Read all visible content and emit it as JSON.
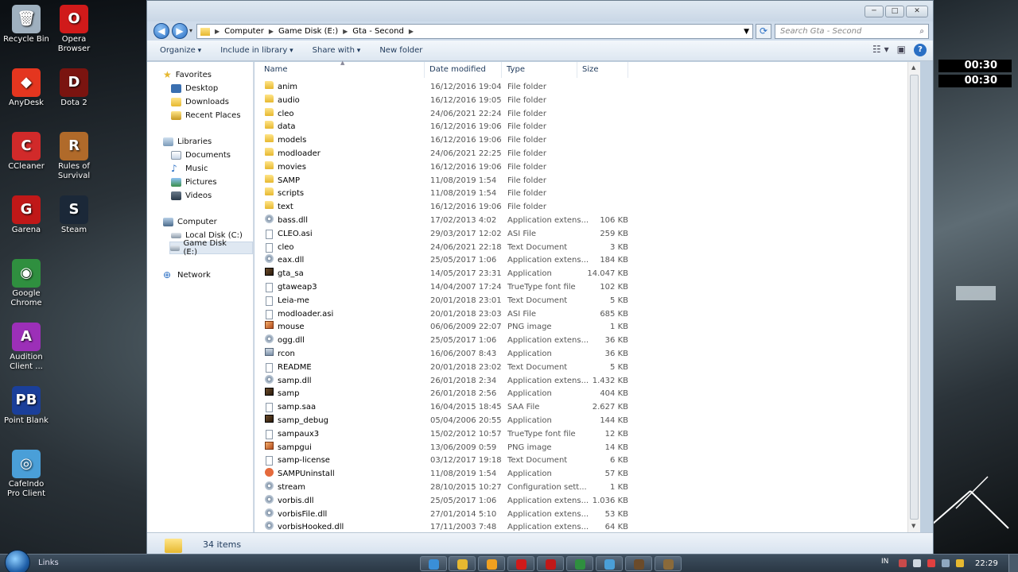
{
  "desktop": {
    "icons": [
      {
        "label": "Recycle Bin",
        "color": "#9fb0bf",
        "glyph": "🗑"
      },
      {
        "label": "Opera Browser",
        "color": "#d01a1a",
        "glyph": "O"
      },
      {
        "label": "AnyDesk",
        "color": "#e4361f",
        "glyph": "◆"
      },
      {
        "label": "Dota 2",
        "color": "#7a1410",
        "glyph": "D"
      },
      {
        "label": "CCleaner",
        "color": "#d12a2a",
        "glyph": "C"
      },
      {
        "label": "Rules of Survival",
        "color": "#b06a2a",
        "glyph": "R"
      },
      {
        "label": "Garena",
        "color": "#c01818",
        "glyph": "G"
      },
      {
        "label": "Steam",
        "color": "#1b2838",
        "glyph": "S"
      },
      {
        "label": "Google Chrome",
        "color": "#2f8f3f",
        "glyph": "◉"
      },
      {
        "label": "Audition Client ...",
        "color": "#9c2fb8",
        "glyph": "A"
      },
      {
        "label": "Point Blank",
        "color": "#1a3f9a",
        "glyph": "PB"
      },
      {
        "label": "CafeIndo Pro Client",
        "color": "#4a9fd8",
        "glyph": "◎"
      }
    ],
    "clocks": [
      "00:30",
      "00:30"
    ]
  },
  "window": {
    "address": {
      "crumbs": [
        "Computer",
        "Game Disk (E:)",
        "Gta - Second"
      ]
    },
    "search_placeholder": "Search Gta - Second",
    "toolbar": {
      "organize": "Organize",
      "include": "Include in library",
      "share": "Share with",
      "new_folder": "New folder"
    },
    "nav": {
      "favorites": "Favorites",
      "desktop": "Desktop",
      "downloads": "Downloads",
      "recent": "Recent Places",
      "libraries": "Libraries",
      "documents": "Documents",
      "music": "Music",
      "pictures": "Pictures",
      "videos": "Videos",
      "computer": "Computer",
      "local_disk": "Local Disk (C:)",
      "game_disk": "Game Disk (E:)",
      "network": "Network"
    },
    "columns": {
      "name": "Name",
      "date": "Date modified",
      "type": "Type",
      "size": "Size"
    },
    "files": [
      {
        "name": "anim",
        "date": "16/12/2016 19:04",
        "type": "File folder",
        "size": "",
        "icon": "folder"
      },
      {
        "name": "audio",
        "date": "16/12/2016 19:05",
        "type": "File folder",
        "size": "",
        "icon": "folder"
      },
      {
        "name": "cleo",
        "date": "24/06/2021 22:24",
        "type": "File folder",
        "size": "",
        "icon": "folder"
      },
      {
        "name": "data",
        "date": "16/12/2016 19:06",
        "type": "File folder",
        "size": "",
        "icon": "folder"
      },
      {
        "name": "models",
        "date": "16/12/2016 19:06",
        "type": "File folder",
        "size": "",
        "icon": "folder"
      },
      {
        "name": "modloader",
        "date": "24/06/2021 22:25",
        "type": "File folder",
        "size": "",
        "icon": "folder"
      },
      {
        "name": "movies",
        "date": "16/12/2016 19:06",
        "type": "File folder",
        "size": "",
        "icon": "folder"
      },
      {
        "name": "SAMP",
        "date": "11/08/2019 1:54",
        "type": "File folder",
        "size": "",
        "icon": "folder"
      },
      {
        "name": "scripts",
        "date": "11/08/2019 1:54",
        "type": "File folder",
        "size": "",
        "icon": "folder"
      },
      {
        "name": "text",
        "date": "16/12/2016 19:06",
        "type": "File folder",
        "size": "",
        "icon": "folder"
      },
      {
        "name": "bass.dll",
        "date": "17/02/2013 4:02",
        "type": "Application extens...",
        "size": "106 KB",
        "icon": "gear"
      },
      {
        "name": "CLEO.asi",
        "date": "29/03/2017 12:02",
        "type": "ASI File",
        "size": "259 KB",
        "icon": "doc"
      },
      {
        "name": "cleo",
        "date": "24/06/2021 22:18",
        "type": "Text Document",
        "size": "3 KB",
        "icon": "doc"
      },
      {
        "name": "eax.dll",
        "date": "25/05/2017 1:06",
        "type": "Application extens...",
        "size": "184 KB",
        "icon": "gear"
      },
      {
        "name": "gta_sa",
        "date": "14/05/2017 23:31",
        "type": "Application",
        "size": "14.047 KB",
        "icon": "exe2"
      },
      {
        "name": "gtaweap3",
        "date": "14/04/2007 17:24",
        "type": "TrueType font file",
        "size": "102 KB",
        "icon": "doc"
      },
      {
        "name": "Leia-me",
        "date": "20/01/2018 23:01",
        "type": "Text Document",
        "size": "5 KB",
        "icon": "doc"
      },
      {
        "name": "modloader.asi",
        "date": "20/01/2018 23:03",
        "type": "ASI File",
        "size": "685 KB",
        "icon": "doc"
      },
      {
        "name": "mouse",
        "date": "06/06/2009 22:07",
        "type": "PNG image",
        "size": "1 KB",
        "icon": "img"
      },
      {
        "name": "ogg.dll",
        "date": "25/05/2017 1:06",
        "type": "Application extens...",
        "size": "36 KB",
        "icon": "gear"
      },
      {
        "name": "rcon",
        "date": "16/06/2007 8:43",
        "type": "Application",
        "size": "36 KB",
        "icon": "app"
      },
      {
        "name": "README",
        "date": "20/01/2018 23:02",
        "type": "Text Document",
        "size": "5 KB",
        "icon": "doc"
      },
      {
        "name": "samp.dll",
        "date": "26/01/2018 2:34",
        "type": "Application extens...",
        "size": "1.432 KB",
        "icon": "gear"
      },
      {
        "name": "samp",
        "date": "26/01/2018 2:56",
        "type": "Application",
        "size": "404 KB",
        "icon": "exe2"
      },
      {
        "name": "samp.saa",
        "date": "16/04/2015 18:45",
        "type": "SAA File",
        "size": "2.627 KB",
        "icon": "doc"
      },
      {
        "name": "samp_debug",
        "date": "05/04/2006 20:55",
        "type": "Application",
        "size": "144 KB",
        "icon": "exe2"
      },
      {
        "name": "sampaux3",
        "date": "15/02/2012 10:57",
        "type": "TrueType font file",
        "size": "12 KB",
        "icon": "doc"
      },
      {
        "name": "sampgui",
        "date": "13/06/2009 0:59",
        "type": "PNG image",
        "size": "14 KB",
        "icon": "img"
      },
      {
        "name": "samp-license",
        "date": "03/12/2017 19:18",
        "type": "Text Document",
        "size": "6 KB",
        "icon": "doc"
      },
      {
        "name": "SAMPUninstall",
        "date": "11/08/2019 1:54",
        "type": "Application",
        "size": "57 KB",
        "icon": "samp"
      },
      {
        "name": "stream",
        "date": "28/10/2015 10:27",
        "type": "Configuration sett...",
        "size": "1 KB",
        "icon": "gear"
      },
      {
        "name": "vorbis.dll",
        "date": "25/05/2017 1:06",
        "type": "Application extens...",
        "size": "1.036 KB",
        "icon": "gear"
      },
      {
        "name": "vorbisFile.dll",
        "date": "27/01/2014 5:10",
        "type": "Application extens...",
        "size": "53 KB",
        "icon": "gear"
      },
      {
        "name": "vorbisHooked.dll",
        "date": "17/11/2003 7:48",
        "type": "Application extens...",
        "size": "64 KB",
        "icon": "gear"
      }
    ],
    "status": "34 items"
  },
  "taskbar": {
    "links": "Links",
    "apps": [
      "#3a8fd8",
      "#e6b830",
      "#f0a020",
      "#d01a1a",
      "#c01818",
      "#2f8f3f",
      "#4a9fd8",
      "#6b4b2a",
      "#8a6a3a"
    ],
    "lang": "IN",
    "time": "22:29"
  }
}
